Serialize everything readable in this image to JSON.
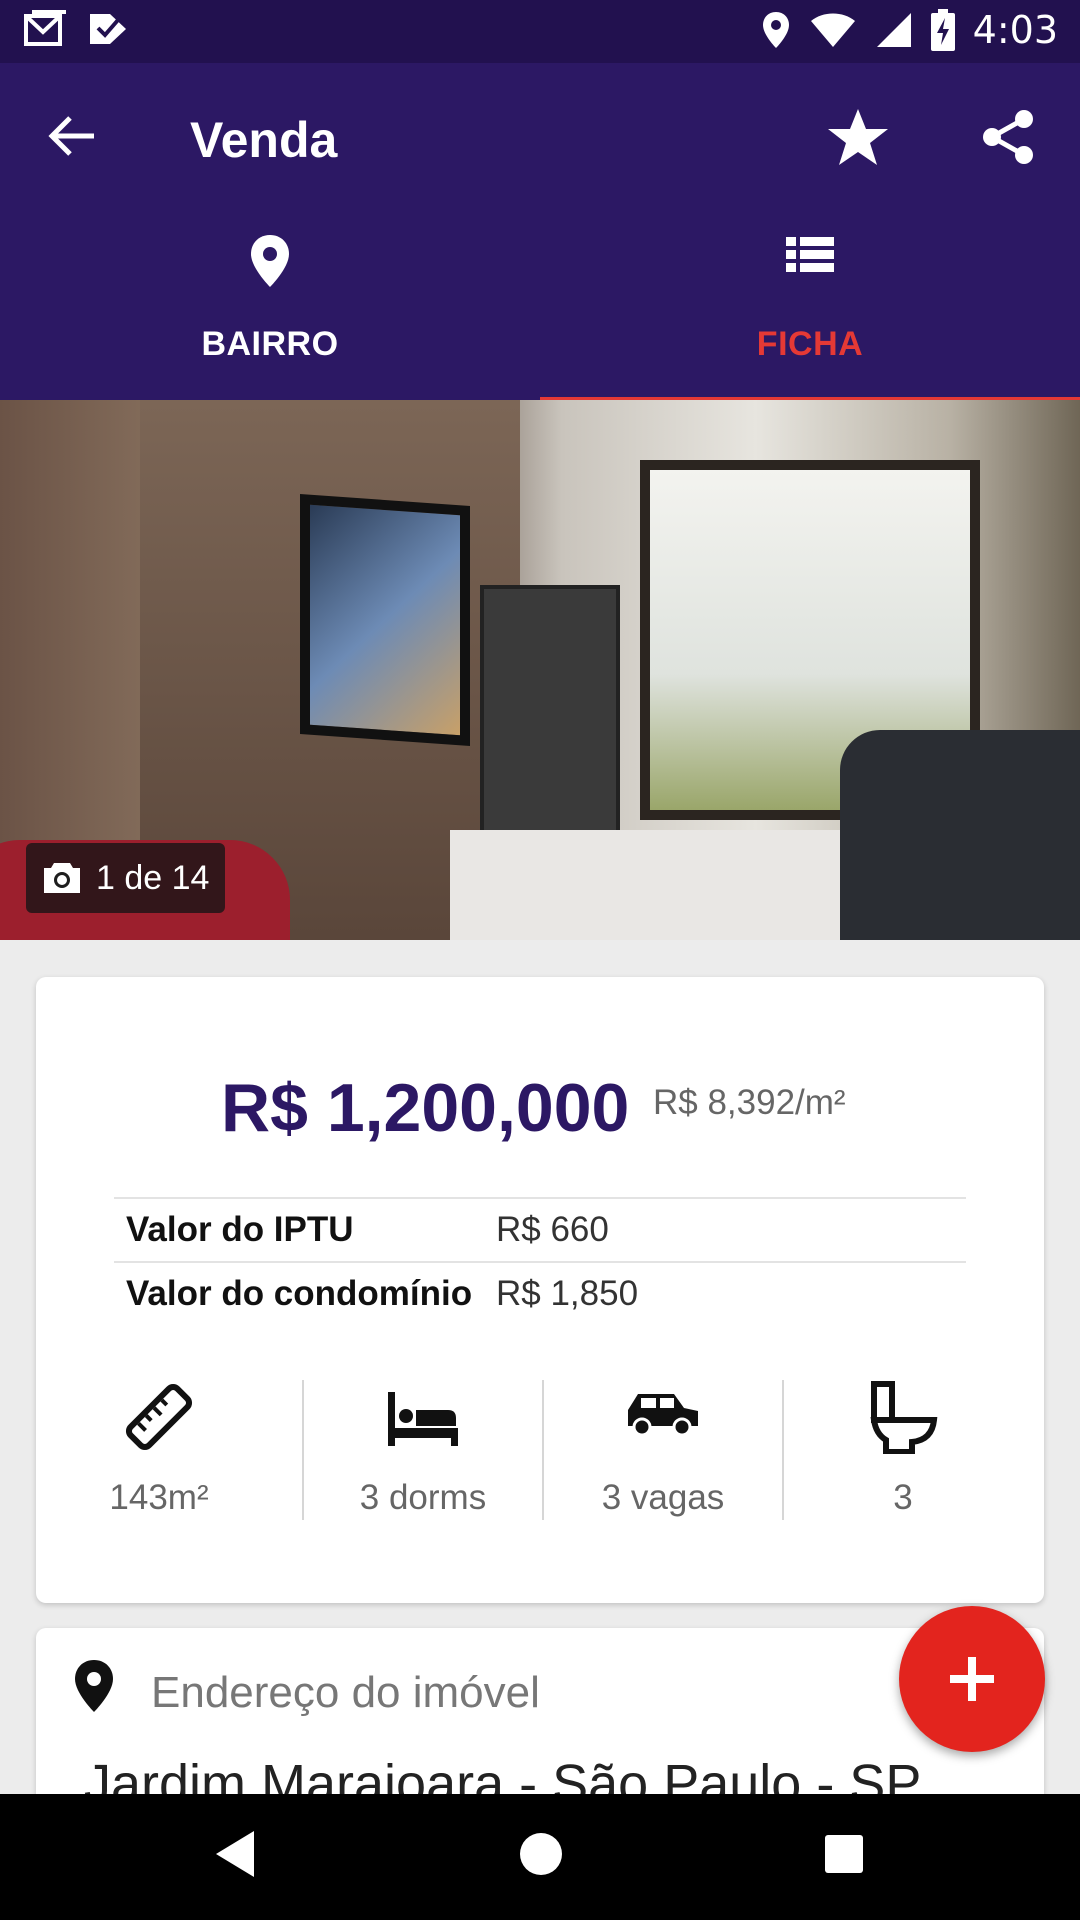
{
  "status_bar": {
    "time": "4:03",
    "icons": [
      "gmail-icon",
      "checkmark-app-icon",
      "location-icon",
      "wifi-icon",
      "signal-icon",
      "battery-charging-icon"
    ]
  },
  "app_bar": {
    "title": "Venda",
    "actions": [
      "back-icon",
      "favorite-star-icon",
      "share-icon"
    ]
  },
  "tabs": [
    {
      "label": "BAIRRO",
      "icon": "map-pin-icon",
      "selected": false
    },
    {
      "label": "FICHA",
      "icon": "list-icon",
      "selected": true
    }
  ],
  "gallery": {
    "counter": "1 de 14",
    "icon": "camera-icon"
  },
  "listing": {
    "price": "R$ 1,200,000",
    "price_per_m2": "R$ 8,392/m²",
    "costs": [
      {
        "label": "Valor do IPTU",
        "value": "R$ 660"
      },
      {
        "label": "Valor do condomínio",
        "value": "R$ 1,850"
      }
    ],
    "features": [
      {
        "icon": "ruler-icon",
        "label": "143m²"
      },
      {
        "icon": "bed-icon",
        "label": "3 dorms"
      },
      {
        "icon": "car-icon",
        "label": "3 vagas"
      },
      {
        "icon": "toilet-icon",
        "label": "3"
      }
    ]
  },
  "address": {
    "label": "Endereço do imóvel",
    "value": "Jardim Marajoara - São Paulo - SP"
  },
  "fab": {
    "icon": "plus-icon"
  },
  "colors": {
    "status_bar": "#22114f",
    "app_bar": "#2c1864",
    "accent": "#e53935",
    "fab": "#e3241e",
    "price": "#2c1864"
  },
  "nav_bar": [
    "back-triangle-icon",
    "home-circle-icon",
    "recents-square-icon"
  ]
}
